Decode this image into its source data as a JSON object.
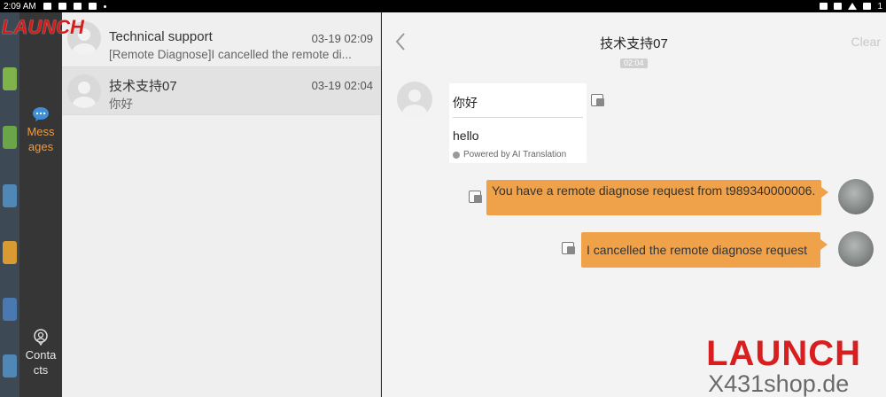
{
  "status_bar": {
    "time": "2:09 AM",
    "battery": "1"
  },
  "logo": "LAUNCH",
  "nav": {
    "messages_label": "Mess ages",
    "contacts_label": "Conta cts"
  },
  "conversations": [
    {
      "name": "Technical support",
      "time": "03-19 02:09",
      "preview": "[Remote Diagnose]I cancelled the remote di..."
    },
    {
      "name": "技术支持07",
      "time": "03-19 02:04",
      "preview": "你好"
    }
  ],
  "chat": {
    "title": "技术支持07",
    "clear_label": "Clear",
    "timestamp": "02:04",
    "incoming": {
      "original": "你好",
      "translation": "hello",
      "powered_by": "Powered by AI Translation"
    },
    "outgoing": [
      "You have a remote diagnose request from t989340000006.",
      "I cancelled the remote diagnose request"
    ]
  },
  "watermark": {
    "brand": "LAUNCH",
    "site": "X431shop.de"
  },
  "colors": {
    "accent_orange": "#f09a3e",
    "bubble_orange": "#f0a24a",
    "brand_red": "#d81e1e"
  }
}
